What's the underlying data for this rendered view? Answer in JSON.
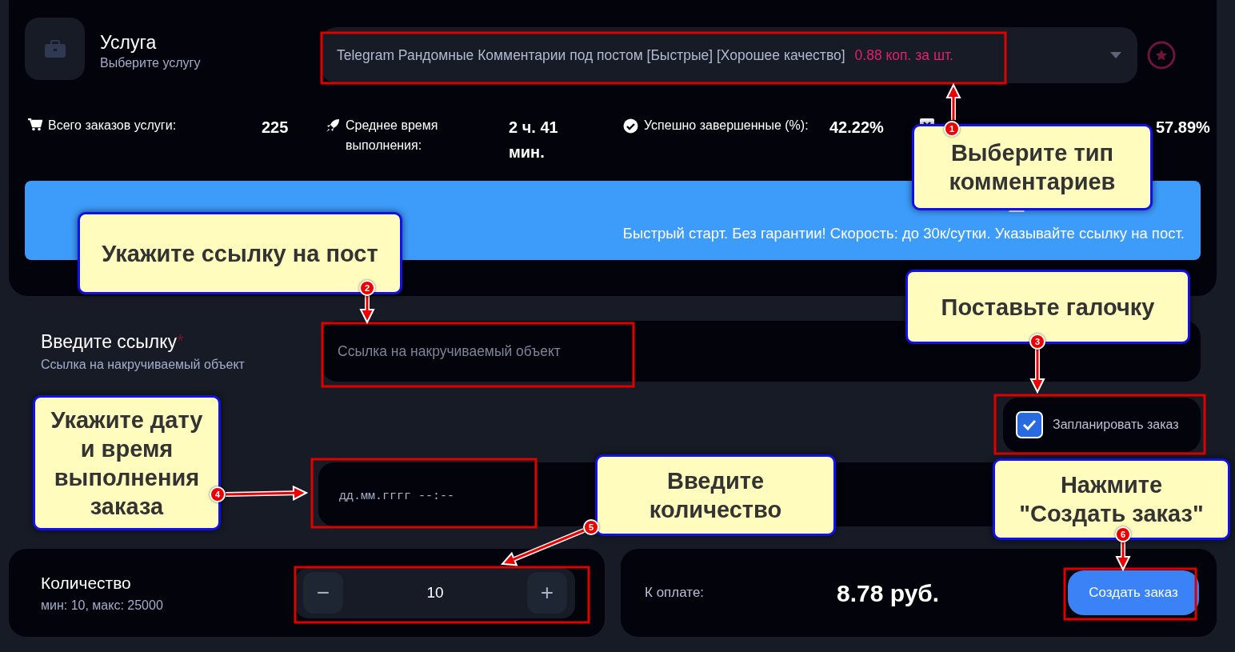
{
  "service": {
    "title": "Услуга",
    "subtitle": "Выберите услугу",
    "selected_service": "Telegram Рандомные Комментарии под постом [Быстрые] [Хорошее качество]",
    "price": "0.88 коп. за шт."
  },
  "stats": [
    {
      "kind": "cart",
      "label": "Всего заказов услуги:",
      "value": "225"
    },
    {
      "kind": "rocket",
      "label": "Среднее время выполнения:",
      "value": "2 ч. 41 мин."
    },
    {
      "kind": "check",
      "label": "Успешно завершенные (%):",
      "value": "42.22%"
    },
    {
      "kind": "cross",
      "value": "57.89%"
    }
  ],
  "notice": {
    "text": "Быстрый старт. Без гарантии! Скорость: до 30к/сутки. Указывайте ссылку на пост."
  },
  "link": {
    "label": "Введите ссылку",
    "required_mark": "*",
    "hint": "Ссылка на накручиваемый объект",
    "placeholder": "Ссылка на накручиваемый объект"
  },
  "schedule": {
    "label": "Запланировать заказ",
    "checked": true
  },
  "date": {
    "placeholder": "дд.мм.гггг --:--"
  },
  "quantity": {
    "label": "Количество",
    "limits": "мин: 10, макс: 25000",
    "minus": "−",
    "value": "10",
    "plus": "+"
  },
  "payment": {
    "label": "К оплате:",
    "amount": "8.78 руб.",
    "button": "Создать заказ"
  },
  "annotations": [
    {
      "number": "1",
      "text": "Выберите тип комментариев"
    },
    {
      "number": "2",
      "text": "Укажите ссылку на пост"
    },
    {
      "number": "3",
      "text": "Поставьте галочку"
    },
    {
      "number": "4",
      "text": "Укажите дату и время выполнения заказа"
    },
    {
      "number": "5",
      "text": "Введите количество"
    },
    {
      "number": "6",
      "text": "Нажмите \"Создать заказ\""
    }
  ]
}
